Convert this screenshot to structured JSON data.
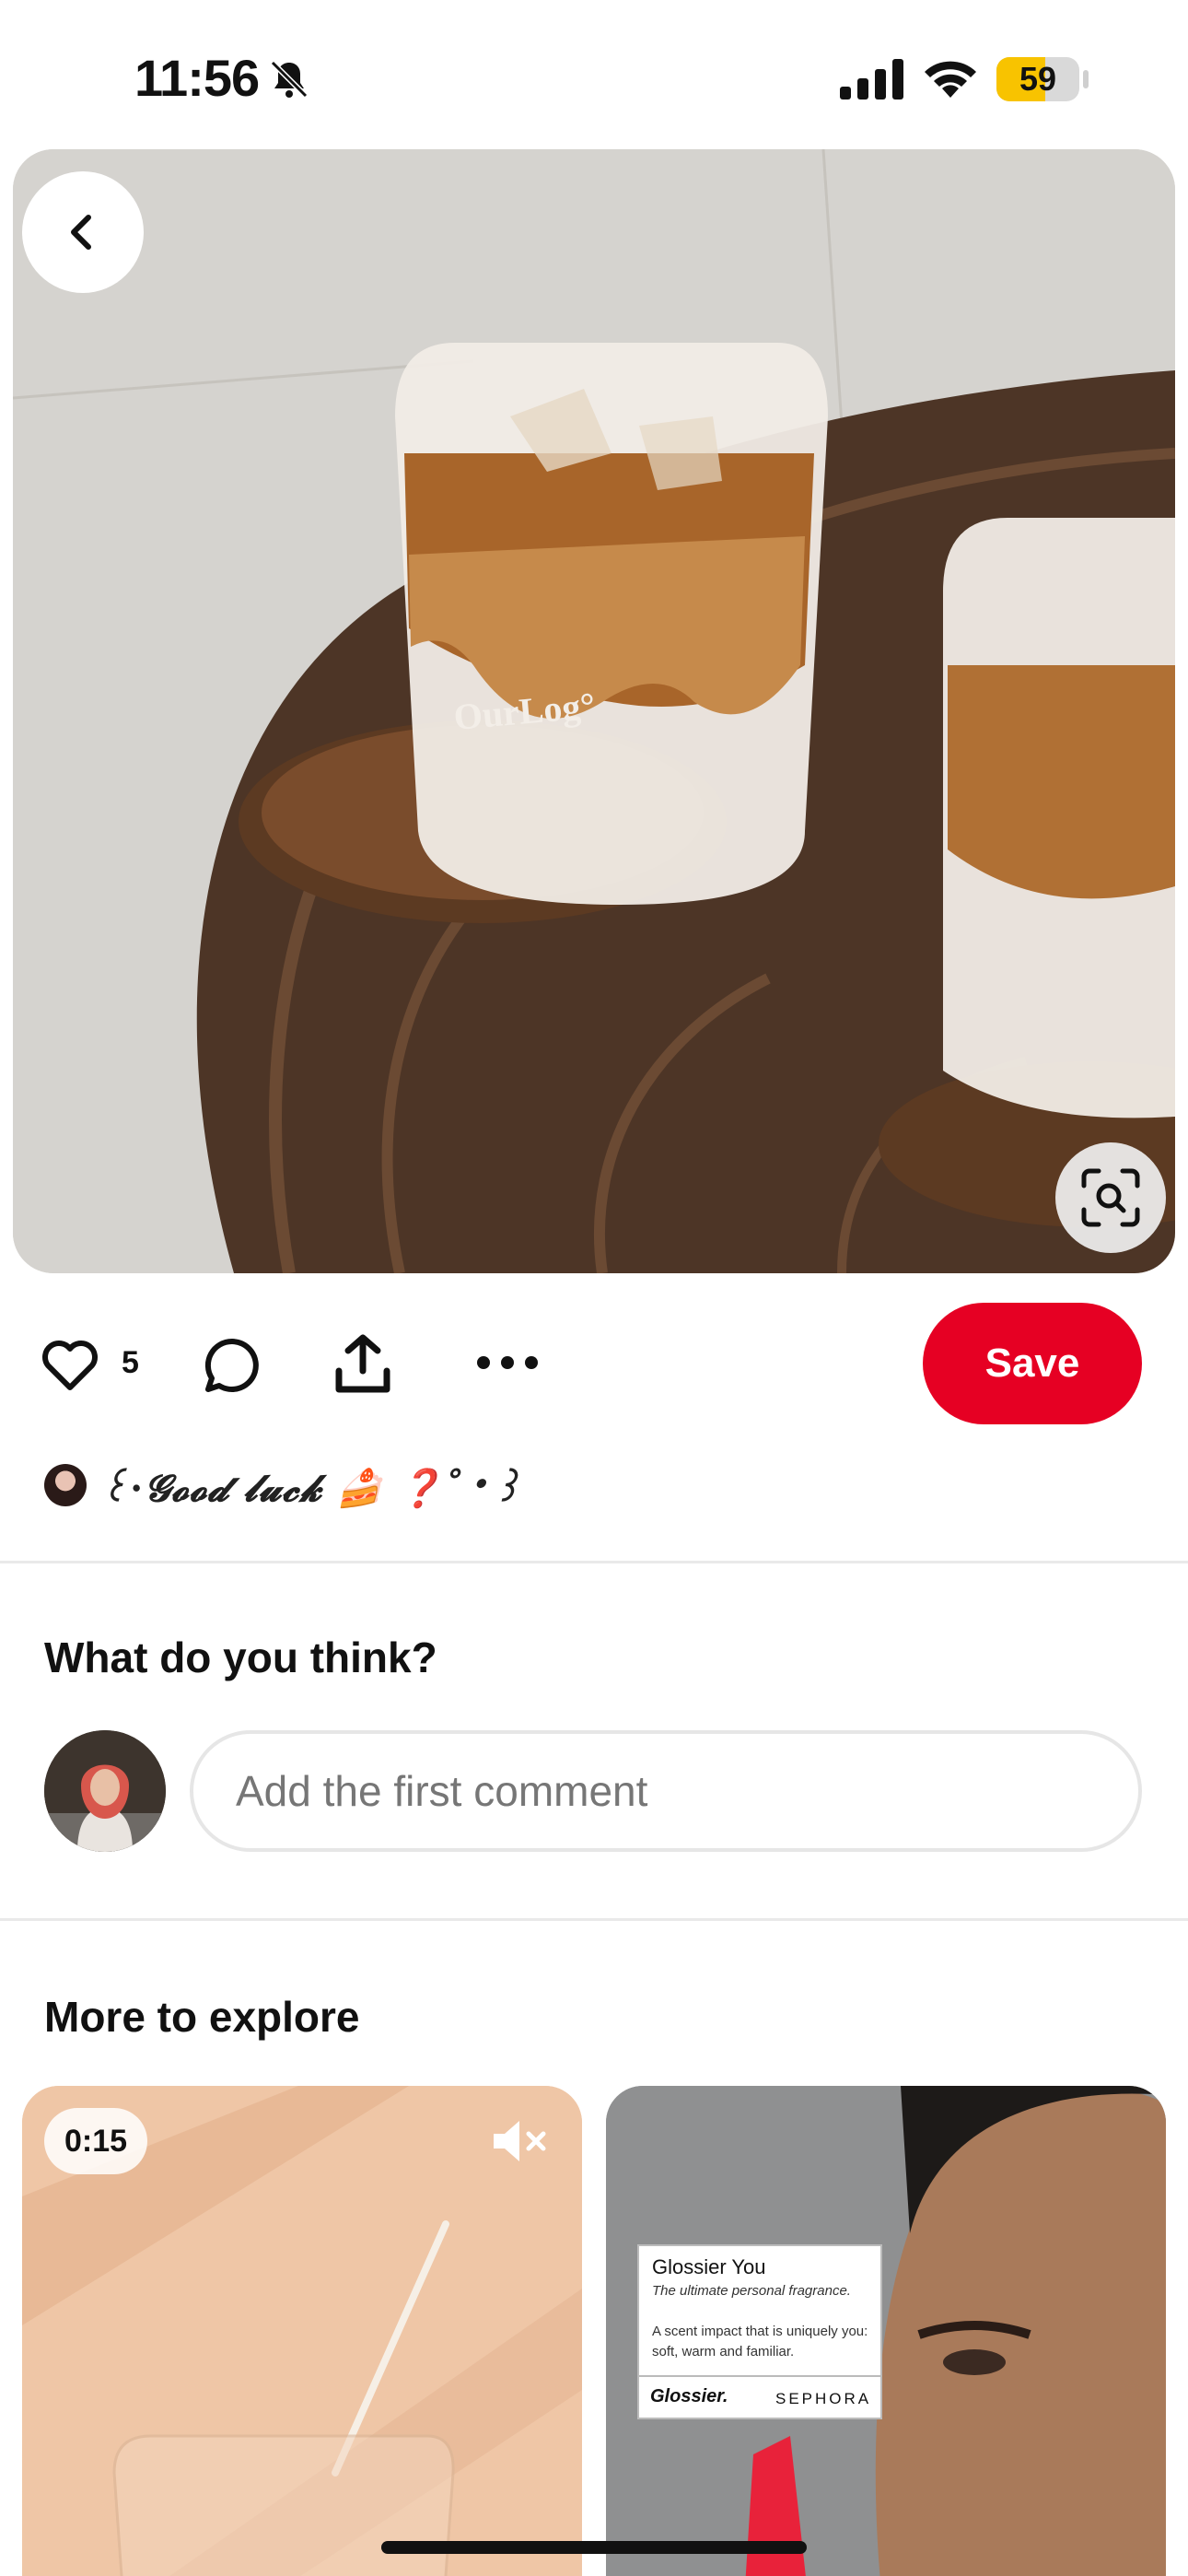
{
  "status_bar": {
    "time": "11:56",
    "battery_level": "59",
    "battery_fraction": 0.59,
    "battery_color": "#f8c300"
  },
  "pin": {
    "image_watermark": "OurLog°",
    "back_icon": "chevron-left-icon",
    "visual_search_icon": "visual-search-icon"
  },
  "actions": {
    "like_count": "5",
    "save_label": "Save",
    "save_color": "#e60023",
    "icons": [
      "heart-icon",
      "comment-icon",
      "share-icon",
      "more-icon"
    ]
  },
  "author": {
    "name": "꒰⋅𝓖𝓸𝓸𝓭 𝓵𝓾𝓬𝓴 🍰 ❓˚‧꒱"
  },
  "comments": {
    "heading": "What do you think?",
    "placeholder": "Add the first comment"
  },
  "explore": {
    "heading": "More to explore",
    "cards": [
      {
        "duration": "0:15",
        "muted": true
      },
      {
        "ad_title": "Glossier You",
        "ad_subtitle": "The ultimate personal fragrance.",
        "ad_body": "A scent impact that is uniquely you: soft, warm and familiar.",
        "ad_brand": "Glossier.",
        "ad_retailer": "SEPHORA"
      }
    ]
  }
}
